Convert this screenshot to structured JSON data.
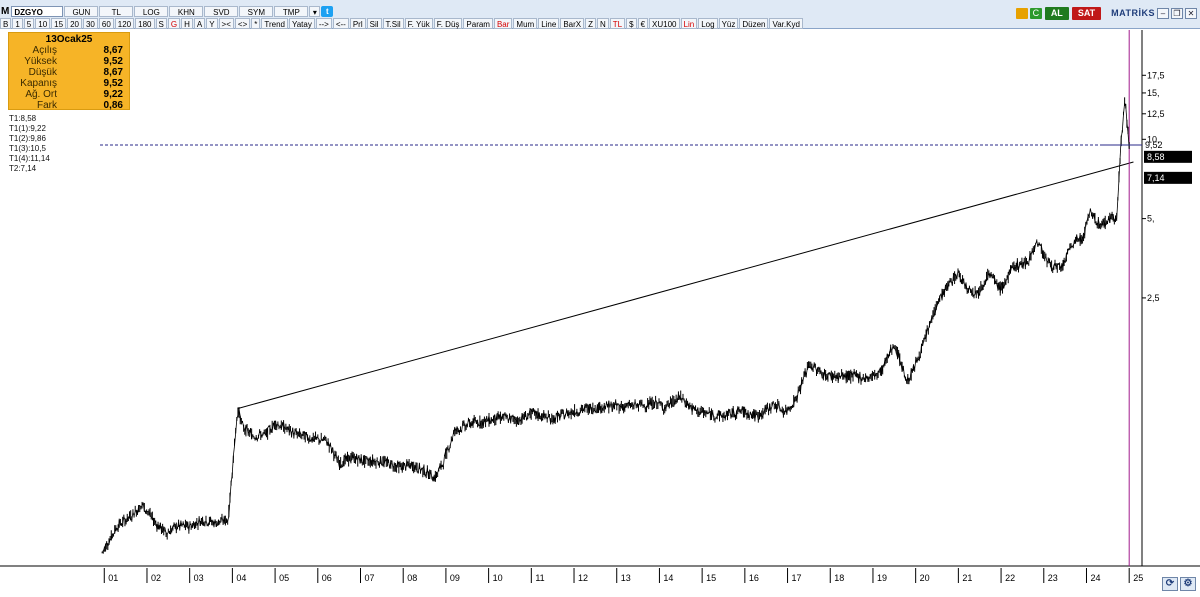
{
  "toolbar": {
    "menu_label": "M",
    "symbol": "DZGYO",
    "period_btn": "GUN",
    "currency_btn": "TL",
    "row1_buttons": [
      "LOG",
      "KHN",
      "SVD",
      "SYM",
      "TMP"
    ],
    "periods": [
      "B",
      "1",
      "5",
      "10",
      "15",
      "20",
      "30",
      "60",
      "120",
      "180",
      "S",
      "G",
      "H",
      "A",
      "Y"
    ],
    "selected_period": "G",
    "tools": [
      {
        "label": "><",
        "red": false
      },
      {
        "label": "<>",
        "red": false
      },
      {
        "label": "*",
        "red": false
      },
      {
        "label": "Trend",
        "red": false
      },
      {
        "label": "Yatay",
        "red": false
      },
      {
        "label": "-->",
        "red": false
      },
      {
        "label": "<--",
        "red": false
      },
      {
        "label": "Prl",
        "red": false
      },
      {
        "label": "Sil",
        "red": false
      },
      {
        "label": "T.Sil",
        "red": false
      },
      {
        "label": "F. Yük",
        "red": false
      },
      {
        "label": "F. Düş",
        "red": false
      },
      {
        "label": "Param",
        "red": false
      },
      {
        "label": "Bar",
        "red": true
      },
      {
        "label": "Mum",
        "red": false
      },
      {
        "label": "Line",
        "red": false
      },
      {
        "label": "BarX",
        "red": false
      },
      {
        "label": "Z",
        "red": false
      },
      {
        "label": "N",
        "red": false
      },
      {
        "label": "TL",
        "red": true
      },
      {
        "label": "$",
        "red": false
      },
      {
        "label": "€",
        "red": false
      },
      {
        "label": "XU100",
        "red": false
      },
      {
        "label": "Lin",
        "red": true
      },
      {
        "label": "Log",
        "red": false
      },
      {
        "label": "Yüz",
        "red": false
      },
      {
        "label": "Düzen",
        "red": false
      },
      {
        "label": "Var.Kyd",
        "red": false
      }
    ],
    "refresh_glyph": "C",
    "buy_label": "AL",
    "sell_label": "SAT",
    "brand": "MATRİKS"
  },
  "info": {
    "date": "13Ocak25",
    "rows": [
      {
        "label": "Açılış",
        "value": "8,67"
      },
      {
        "label": "Yüksek",
        "value": "9,52"
      },
      {
        "label": "Düşük",
        "value": "8,67"
      },
      {
        "label": "Kapanış",
        "value": "9,52"
      },
      {
        "label": "Ağ. Ort",
        "value": "9,22"
      },
      {
        "label": "Fark",
        "value": "0,86"
      }
    ]
  },
  "levels": [
    "T1:8,58",
    "T1(1):9,22",
    "T1(2):9,86",
    "T1(3):10,5",
    "T1(4):11,14",
    "T2:7,14"
  ],
  "colors": {
    "toolbar_bg": "#dfe9f5",
    "info_bg": "#f6b427",
    "cursor_line": "#a01a8c",
    "dashed_line": "#2a2a8a",
    "label_box": "#000000",
    "bar_color": "#000000"
  },
  "chart_data": {
    "type": "line",
    "style": "ohlc-bar",
    "symbol": "DZGYO",
    "y_scale": "log",
    "x_ticks": [
      "01",
      "02",
      "03",
      "04",
      "05",
      "06",
      "07",
      "08",
      "09",
      "10",
      "11",
      "12",
      "13",
      "14",
      "15",
      "16",
      "17",
      "18",
      "19",
      "20",
      "21",
      "22",
      "23",
      "24",
      "25"
    ],
    "y_ticks": [
      "17,5",
      "15,",
      "12,5",
      "10,",
      "5,",
      "2,5"
    ],
    "y_tick_values": [
      17.5,
      15,
      12.5,
      10,
      5,
      2.5
    ],
    "price_labels": [
      {
        "label": "9,52",
        "value": 9.52,
        "style": "plain"
      },
      {
        "label": "8,58",
        "value": 8.58,
        "style": "boxed"
      },
      {
        "label": "7,14",
        "value": 7.14,
        "style": "boxed"
      }
    ],
    "series": [
      {
        "x": [
          2000.95,
          2001.3,
          2001.6,
          2001.9,
          2002.2,
          2002.45,
          2002.7,
          2003.0,
          2003.3,
          2003.6,
          2003.9,
          2004.05,
          2004.12,
          2004.25,
          2004.5,
          2004.8,
          2005.0,
          2005.5,
          2005.9,
          2006.2,
          2006.5,
          2006.8,
          2007.1,
          2007.5,
          2007.9,
          2008.2,
          2008.5,
          2008.75,
          2008.95,
          2009.2,
          2009.6,
          2009.9,
          2010.3,
          2010.7,
          2011.0,
          2011.5,
          2011.9,
          2012.3,
          2012.8,
          2013.2,
          2013.6,
          2013.95,
          2014.1,
          2014.5,
          2014.8,
          2015.1,
          2015.5,
          2015.9,
          2016.3,
          2016.7,
          2016.95,
          2017.2,
          2017.5,
          2017.9,
          2018.2,
          2018.6,
          2018.9,
          2019.2,
          2019.5,
          2019.8,
          2019.95,
          2020.2,
          2020.5,
          2020.8,
          2021.0,
          2021.2,
          2021.45,
          2021.7,
          2022.0,
          2022.3,
          2022.6,
          2022.85,
          2023.1,
          2023.4,
          2023.7,
          2023.9,
          2024.1,
          2024.3,
          2024.55,
          2024.7,
          2024.8,
          2024.9,
          2025.0
        ],
        "y": [
          0.27,
          0.34,
          0.37,
          0.41,
          0.35,
          0.32,
          0.34,
          0.34,
          0.36,
          0.35,
          0.36,
          0.7,
          0.95,
          0.8,
          0.75,
          0.76,
          0.84,
          0.76,
          0.73,
          0.72,
          0.59,
          0.62,
          0.6,
          0.6,
          0.57,
          0.58,
          0.55,
          0.52,
          0.6,
          0.78,
          0.84,
          0.85,
          0.88,
          0.86,
          0.91,
          0.87,
          0.92,
          0.95,
          0.97,
          0.97,
          0.98,
          1.0,
          0.96,
          1.05,
          0.94,
          0.91,
          0.89,
          0.93,
          0.89,
          0.99,
          0.92,
          1.04,
          1.4,
          1.27,
          1.26,
          1.26,
          1.24,
          1.32,
          1.68,
          1.2,
          1.34,
          1.7,
          2.4,
          2.85,
          3.1,
          2.75,
          2.6,
          3.1,
          2.7,
          3.3,
          3.4,
          4.1,
          3.4,
          3.2,
          4.1,
          4.2,
          5.3,
          4.7,
          5.0,
          5.0,
          9.3,
          14.2,
          9.52
        ]
      }
    ],
    "trendline": {
      "x": [
        2004.12,
        2025.1
      ],
      "y": [
        0.95,
        8.2
      ]
    },
    "dashed_level": 9.52,
    "cursor_x": 2025.0,
    "xlim": [
      2000.9,
      2025.3
    ],
    "ylim": [
      0.24,
      26
    ]
  }
}
